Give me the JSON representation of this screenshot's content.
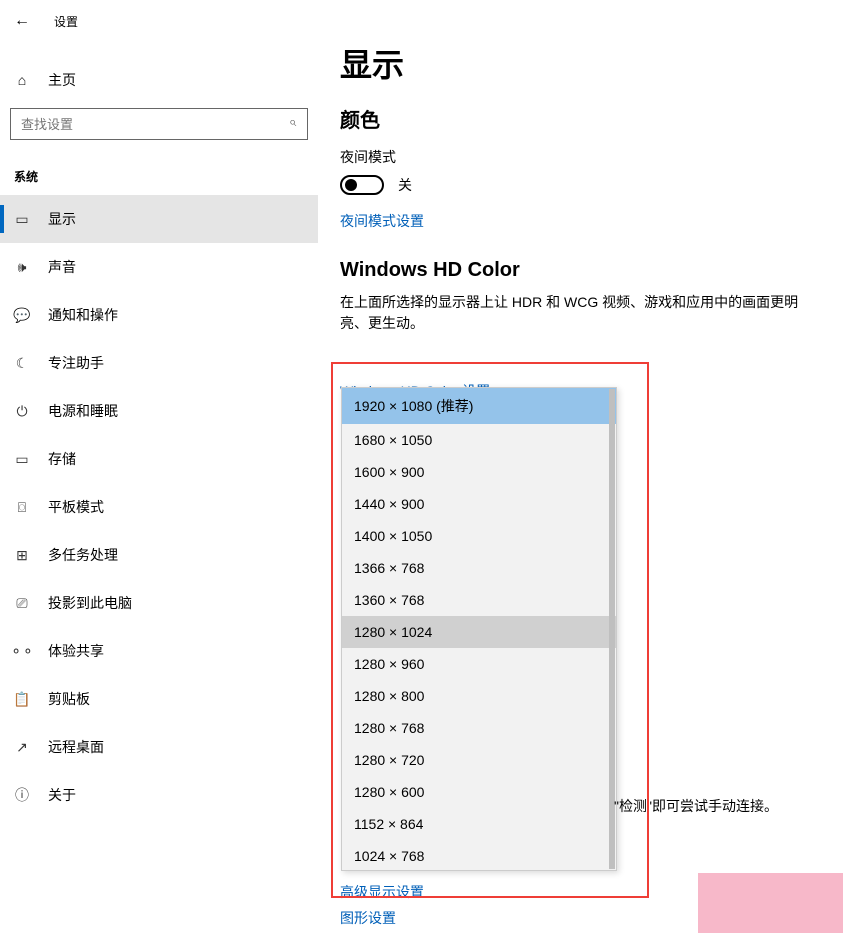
{
  "titlebar": {
    "label": "设置"
  },
  "home": {
    "label": "主页"
  },
  "search": {
    "placeholder": "查找设置"
  },
  "group_label": "系统",
  "nav": [
    {
      "label": "显示",
      "icon": "display-icon",
      "active": true
    },
    {
      "label": "声音",
      "icon": "sound-icon"
    },
    {
      "label": "通知和操作",
      "icon": "notifications-icon"
    },
    {
      "label": "专注助手",
      "icon": "focus-assist-icon"
    },
    {
      "label": "电源和睡眠",
      "icon": "power-icon"
    },
    {
      "label": "存储",
      "icon": "storage-icon"
    },
    {
      "label": "平板模式",
      "icon": "tablet-icon"
    },
    {
      "label": "多任务处理",
      "icon": "multitask-icon"
    },
    {
      "label": "投影到此电脑",
      "icon": "project-icon"
    },
    {
      "label": "体验共享",
      "icon": "shared-icon"
    },
    {
      "label": "剪贴板",
      "icon": "clipboard-icon"
    },
    {
      "label": "远程桌面",
      "icon": "remote-icon"
    },
    {
      "label": "关于",
      "icon": "about-icon"
    }
  ],
  "page": {
    "title": "显示",
    "color_heading": "颜色",
    "night_mode_label": "夜间模式",
    "toggle_off": "关",
    "night_mode_link": "夜间模式设置",
    "hdcolor_heading": "Windows HD Color",
    "hdcolor_desc": "在上面所选择的显示器上让 HDR 和 WCG 视频、游戏和应用中的画面更明亮、更生动。",
    "hdcolor_link": "Windows HD Color 设置",
    "detect_trail": "\"检测\"即可尝试手动连接。",
    "adv_link": "高级显示设置",
    "graphics_link": "图形设置"
  },
  "resolutions": [
    {
      "label": "1920 × 1080 (推荐)",
      "selected": true
    },
    {
      "label": "1680 × 1050"
    },
    {
      "label": "1600 × 900"
    },
    {
      "label": "1440 × 900"
    },
    {
      "label": "1400 × 1050"
    },
    {
      "label": "1366 × 768"
    },
    {
      "label": "1360 × 768"
    },
    {
      "label": "1280 × 1024",
      "hover": true
    },
    {
      "label": "1280 × 960"
    },
    {
      "label": "1280 × 800"
    },
    {
      "label": "1280 × 768"
    },
    {
      "label": "1280 × 720"
    },
    {
      "label": "1280 × 600"
    },
    {
      "label": "1152 × 864"
    },
    {
      "label": "1024 × 768"
    }
  ]
}
